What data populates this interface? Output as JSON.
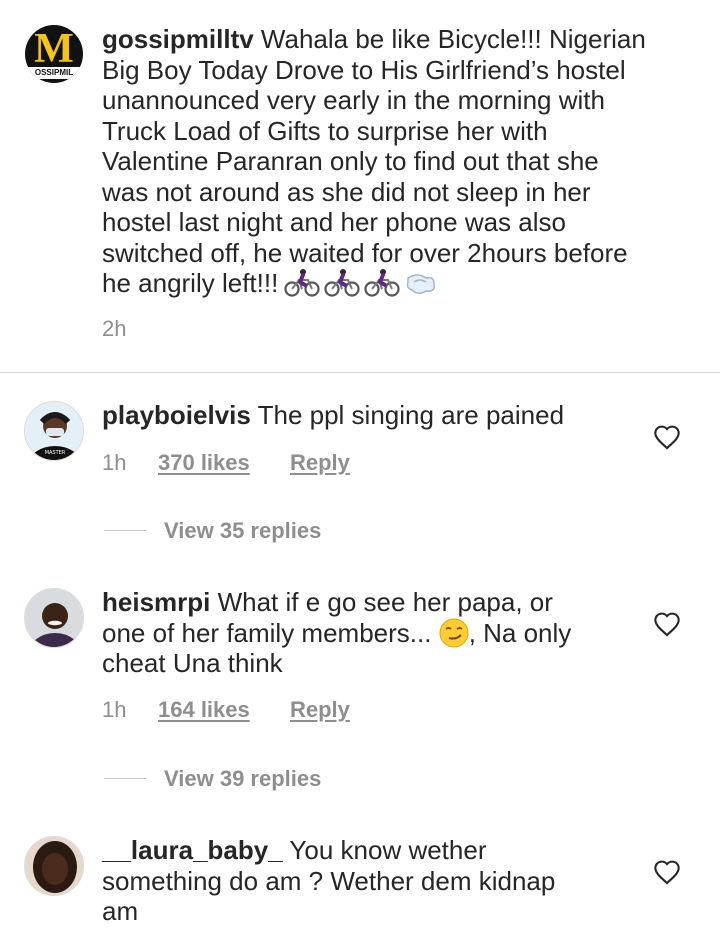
{
  "post": {
    "username": "gossipmilltv",
    "avatar_letter": "M",
    "avatar_banner": "OSSIPMIL",
    "caption_lines": [
      " Wahala be like Bicycle!!! Nigerian",
      "Big Boy Today Drove to His Girlfriend’s hostel",
      "unannounced very early in the morning with",
      "Truck Load of Gifts to surprise her with",
      "Valentine Paranran only to find out that she",
      "was not around as she did not sleep in her",
      "hostel last night and her phone was also",
      "switched off, he waited for over 2hours before",
      "he angrily left!!!"
    ],
    "emojis": [
      "bicycle-rider-icon",
      "bicycle-rider-icon",
      "bicycle-rider-icon",
      "dash-icon"
    ],
    "time": "2h"
  },
  "comments": [
    {
      "username": "playboielvis",
      "lines": [
        " The ppl singing are pained"
      ],
      "time": "1h",
      "likes": "370 likes",
      "reply": "Reply",
      "view_replies": "View 35 replies"
    },
    {
      "username": "heismrpi",
      "lines": [
        " What if e go see her papa, or",
        "one of her family members... ",
        "cheat Una think"
      ],
      "line2_suffix": ", Na only",
      "emoji": "smirk-icon",
      "time": "1h",
      "likes": "164 likes",
      "reply": "Reply",
      "view_replies": "View 39 replies"
    },
    {
      "username": "__laura_baby_",
      "lines": [
        " You know wether",
        "something do am ? Wether dem kidnap",
        "am"
      ]
    }
  ],
  "colors": {
    "text": "#262626",
    "muted": "#8e8e8e",
    "divider": "#dbdbdb",
    "avatar_yellow": "#f2c31b"
  }
}
